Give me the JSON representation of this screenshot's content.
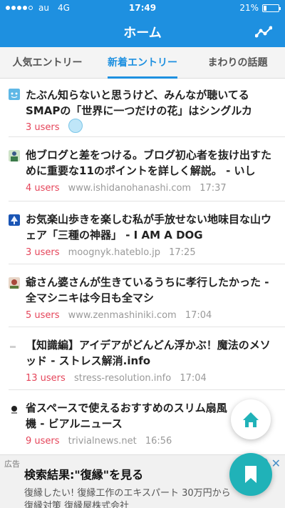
{
  "status_bar": {
    "carrier": "au",
    "network": "4G",
    "time": "17:49",
    "battery": "21%",
    "battery_level": 0.21
  },
  "header": {
    "title": "ホーム",
    "menu_icon": "graph-icon"
  },
  "tabs": [
    {
      "label": "人気エントリー",
      "active": false
    },
    {
      "label": "新着エントリー",
      "active": true
    },
    {
      "label": "まわりの話題",
      "active": false
    }
  ],
  "entries": [
    {
      "title": "たぶん知らないと思うけど、みんなが聴いてるSMAPの「世界に一つだけの花」はシングルカッ…",
      "users": "3 users",
      "domain": "",
      "time": "",
      "icon": "blue-face-icon"
    },
    {
      "title": "他ブログと差をつける。ブログ初心者を抜け出すために重要な11のポイントを詳しく解説。 - いしだ…",
      "users": "4 users",
      "domain": "www.ishidanohanashi.com",
      "time": "17:37",
      "icon": "person-icon"
    },
    {
      "title": "お気楽山歩きを楽しむ私が手放せない地味目な山ウェア「三種の神器」 - I AM A DOG",
      "users": "3 users",
      "domain": "moognyk.hateblo.jp",
      "time": "17:25",
      "icon": "tree-icon"
    },
    {
      "title": "爺さん婆さんが生きているうちに孝行したかった - 全マシニキは今日も全マシ",
      "users": "5 users",
      "domain": "www.zenmashiniki.com",
      "time": "17:04",
      "icon": "avatar-icon"
    },
    {
      "title": "【知識編】アイデアがどんどん浮かぶ！魔法のメソッド - ストレス解消.info",
      "users": "13 users",
      "domain": "stress-resolution.info",
      "time": "17:04",
      "icon": "site-icon"
    },
    {
      "title": "省スペースで使えるおすすめのスリム扇風機 - ビアルニュース",
      "users": "9 users",
      "domain": "trivialnews.net",
      "time": "16:56",
      "icon": "pin-icon"
    }
  ],
  "ad": {
    "label": "広告",
    "title": "検索結果:\"復縁\"を見る",
    "desc1": "復縁したい! 復縁工作のエキスパート 30万円から",
    "desc2": "復縁対策 復縁屋株式会社",
    "close": "✕"
  },
  "fabs": {
    "home": "home-icon",
    "bookmark": "bookmark-icon"
  },
  "colors": {
    "primary": "#1e90e0",
    "users": "#e5455a",
    "fab_bookmark": "#20b2b8"
  }
}
